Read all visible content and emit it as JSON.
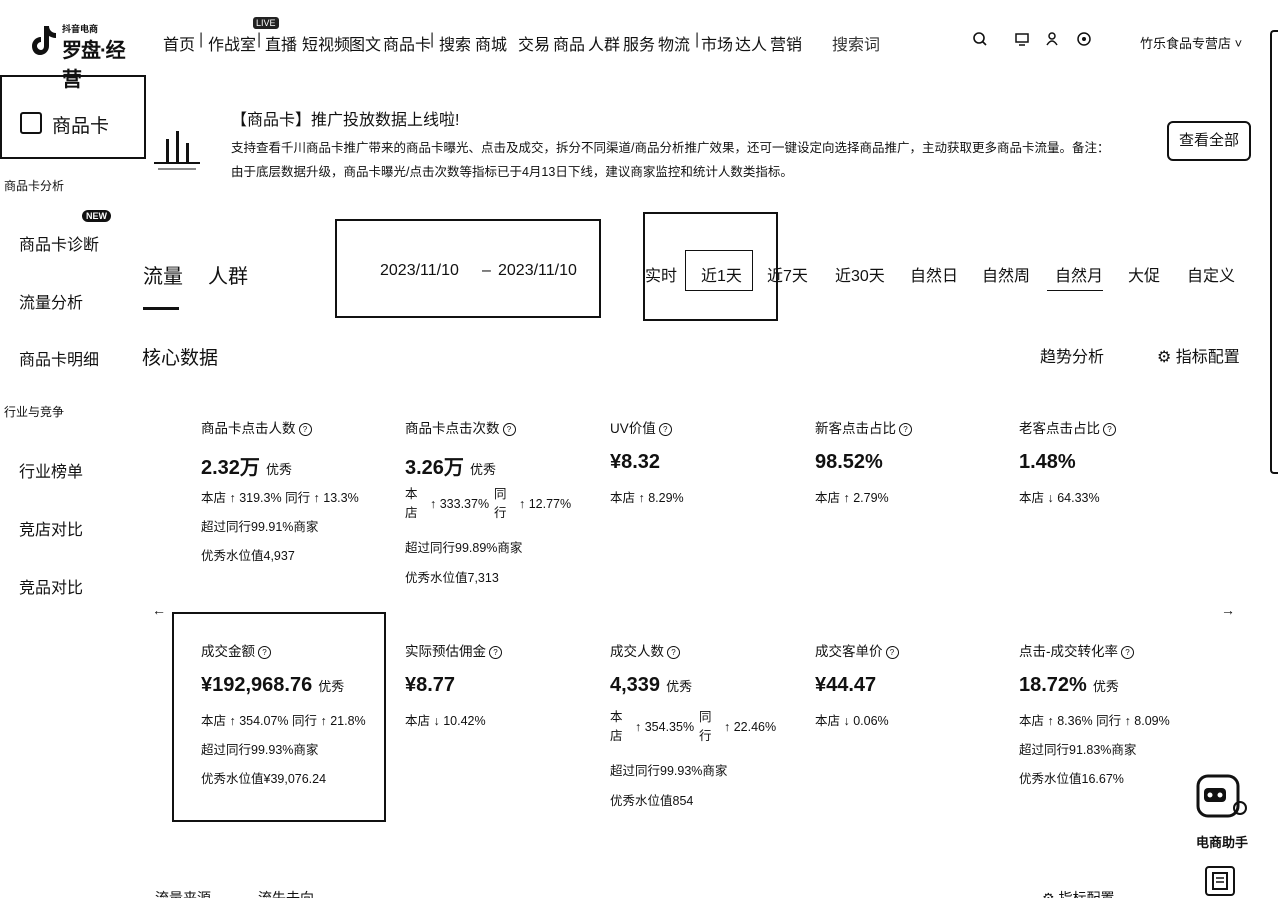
{
  "header": {
    "logo_small": "抖音电商",
    "logo_main": "罗盘·经营",
    "nav": [
      "首页",
      "作战室",
      "直播",
      "短视频",
      "图文",
      "商品卡",
      "搜索",
      "商城",
      "交易",
      "商品",
      "人群",
      "服务",
      "物流",
      "市场",
      "达人",
      "营销"
    ],
    "live_badge": "LIVE",
    "search_placeholder": "搜索词",
    "shop_name": "竹乐食品专营店 ˅"
  },
  "sidebar": {
    "title": "商品卡",
    "group1": "商品卡分析",
    "items1": [
      "商品卡诊断",
      "流量分析",
      "商品卡明细"
    ],
    "new_badge": "NEW",
    "group2": "行业与竞争",
    "items2": [
      "行业榜单",
      "竞店对比",
      "竞品对比"
    ]
  },
  "banner": {
    "title": "【商品卡】推广投放数据上线啦!",
    "desc": "支持查看千川商品卡推广带来的商品卡曝光、点击及成交，拆分不同渠道/商品分析推广效果，还可一键设定向选择商品推广，主动获取更多商品卡流量。备注：由于底层数据升级，商品卡曝光/点击次数等指标已于4月13日下线，建议商家监控和统计人数类指标。",
    "button": "查看全部"
  },
  "tabs": [
    "流量",
    "人群"
  ],
  "date": {
    "start": "2023/11/10",
    "dash": "–",
    "end": "2023/11/10"
  },
  "ranges": [
    "实时",
    "近1天",
    "近7天",
    "近30天",
    "自然日",
    "自然周",
    "自然月",
    "大促",
    "自定义"
  ],
  "selected_range": "近1天",
  "core": {
    "title": "核心数据",
    "trend": "趋势分析",
    "config": "⚙ 指标配置"
  },
  "cards": [
    {
      "name": "商品卡点击人数",
      "value": "2.32万",
      "level": "优秀",
      "l1": "本店 ↑ 319.3% 同行 ↑ 13.3%",
      "l2": "超过同行99.91%商家",
      "l3": "优秀水位值4,937"
    },
    {
      "name": "商品卡点击次数",
      "value": "3.26万",
      "level": "优秀",
      "v1": "本店",
      "v1val": "↑ 333.37%",
      "v2": "同行",
      "v2val": "↑ 12.77%",
      "l2": "超过同行99.89%商家",
      "l3": "优秀水位值7,313"
    },
    {
      "name": "UV价值",
      "value": "¥8.32",
      "level": "",
      "l1": "本店 ↑ 8.29%"
    },
    {
      "name": "新客点击占比",
      "value": "98.52%",
      "level": "",
      "l1": "本店 ↑ 2.79%"
    },
    {
      "name": "老客点击占比",
      "value": "1.48%",
      "level": "",
      "l1": "本店 ↓ 64.33%"
    },
    {
      "name": "成交金额",
      "value": "¥192,968.76",
      "level": "优秀",
      "l1": "本店 ↑ 354.07% 同行 ↑ 21.8%",
      "l2": "超过同行99.93%商家",
      "l3": "优秀水位值¥39,076.24"
    },
    {
      "name": "实际预估佣金",
      "value": "¥8.77",
      "level": "",
      "l1": "本店 ↓ 10.42%"
    },
    {
      "name": "成交人数",
      "value": "4,339",
      "level": "优秀",
      "v1": "本店",
      "v1val": "↑ 354.35%",
      "v2": "同行",
      "v2val": "↑ 22.46%",
      "l2": "超过同行99.93%商家",
      "l3": "优秀水位值854"
    },
    {
      "name": "成交客单价",
      "value": "¥44.47",
      "level": "",
      "l1": "本店 ↓ 0.06%"
    },
    {
      "name": "点击-成交转化率",
      "value": "18.72%",
      "level": "优秀",
      "l1": "本店 ↑ 8.36% 同行 ↑ 8.09%",
      "l2": "超过同行91.83%商家",
      "l3": "优秀水位值16.67%"
    }
  ],
  "bottom": {
    "left": "流量来源",
    "mid": "流失去向",
    "right": "⚙ 指标配置"
  },
  "assistant_label": "电商助手"
}
